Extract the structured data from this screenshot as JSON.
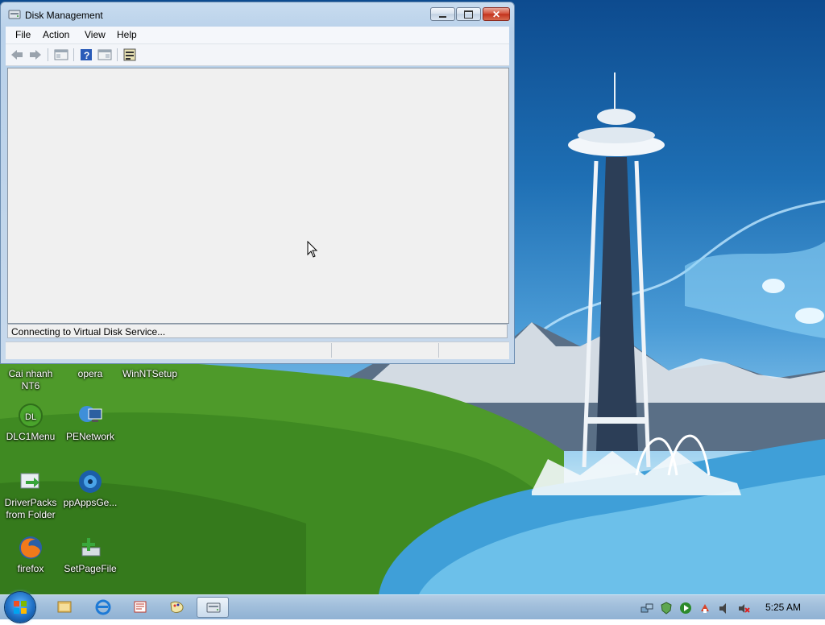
{
  "window": {
    "title": "Disk Management",
    "menu": [
      "File",
      "Action",
      "View",
      "Help"
    ],
    "status_text": "Connecting to Virtual Disk Service...",
    "toolbar_icons": [
      "back-arrow-icon",
      "forward-arrow-icon",
      "show-hide-console-tree-icon",
      "help-icon",
      "show-hide-action-pane-icon",
      "properties-icon"
    ]
  },
  "desktop_icons": [
    {
      "label": "Cai nhanh NT6",
      "icon": "setup-icon"
    },
    {
      "label": "opera",
      "icon": "opera-icon"
    },
    {
      "label": "WinNTSetup",
      "icon": "winntsetup-icon"
    },
    {
      "label": "DLC1Menu",
      "icon": "dlc-menu-icon"
    },
    {
      "label": "PENetwork",
      "icon": "network-icon"
    },
    {
      "label": "DriverPacks from Folder",
      "icon": "driverpacks-icon"
    },
    {
      "label": "ppAppsGe...",
      "icon": "ppapps-icon"
    },
    {
      "label": "firefox",
      "icon": "firefox-icon"
    },
    {
      "label": "SetPageFile",
      "icon": "setpagefile-icon"
    }
  ],
  "taskbar": {
    "items": [
      "explorer-icon",
      "internet-explorer-icon",
      "app-icon",
      "paint-icon",
      "disk-management-icon"
    ],
    "tray": [
      "network-icon",
      "security-icon",
      "media-icon",
      "app-icon",
      "speaker-icon",
      "close-icon"
    ],
    "clock": "5:25 AM"
  },
  "colors": {
    "accent": "#1f6fc4",
    "close_red": "#c3321d"
  }
}
